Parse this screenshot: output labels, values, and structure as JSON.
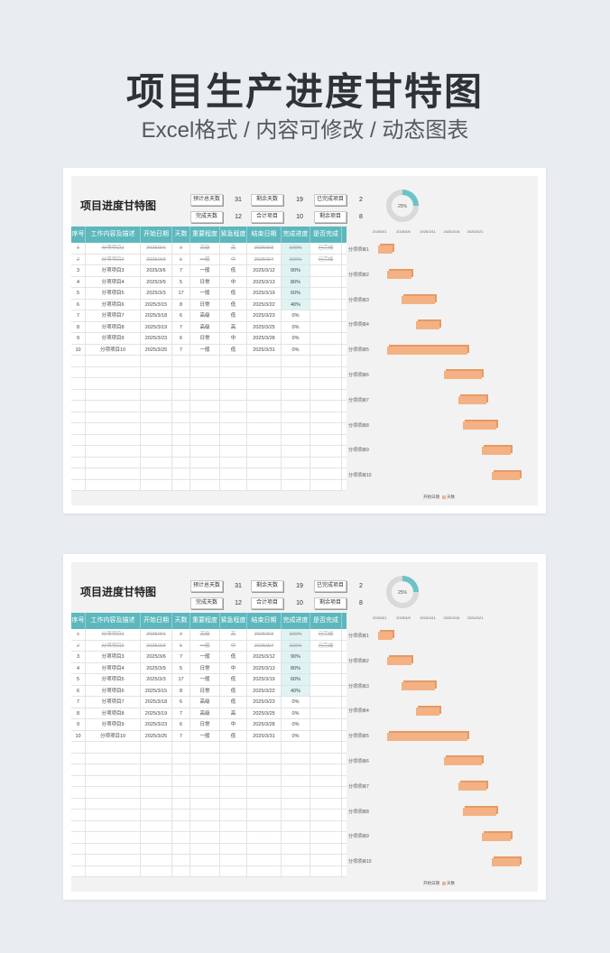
{
  "hero": {
    "title": "项目生产进度甘特图",
    "subtitle": "Excel格式 / 内容可修改 / 动态图表"
  },
  "sheet": {
    "title": "项目进度甘特图",
    "stats": [
      {
        "label": "预计总天数",
        "value": "31"
      },
      {
        "label": "剩余天数",
        "value": "19"
      },
      {
        "label": "已完成项目",
        "value": "2"
      },
      {
        "label": "完成天数",
        "value": "12"
      },
      {
        "label": "合计项目",
        "value": "10"
      },
      {
        "label": "剩余项目",
        "value": "8"
      }
    ],
    "donut": {
      "label": "25%",
      "value": 0.25,
      "color": "#6cc3c7",
      "track": "#d9d9d9"
    }
  },
  "table": {
    "headers": [
      "序号",
      "工作内容及描述",
      "开始日期",
      "天数",
      "重要程度",
      "紧急程度",
      "结束日期",
      "完成进度",
      "是否完成"
    ],
    "rows": [
      {
        "done": true,
        "cells": [
          "1",
          "分项项目1",
          "2025/3/1",
          "3",
          "高级",
          "高",
          "2025/3/3",
          "100%",
          "已完成"
        ]
      },
      {
        "done": true,
        "cells": [
          "2",
          "分项项目2",
          "2025/3/3",
          "5",
          "一般",
          "中",
          "2025/3/7",
          "100%",
          "已完成"
        ]
      },
      {
        "done": false,
        "cells": [
          "3",
          "分项项目3",
          "2025/3/6",
          "7",
          "一般",
          "低",
          "2025/3/12",
          "90%",
          ""
        ]
      },
      {
        "done": false,
        "cells": [
          "4",
          "分项项目4",
          "2025/3/9",
          "5",
          "日常",
          "中",
          "2025/3/13",
          "80%",
          ""
        ]
      },
      {
        "done": false,
        "cells": [
          "5",
          "分项项目5",
          "2025/3/3",
          "17",
          "一般",
          "低",
          "2025/3/19",
          "60%",
          ""
        ]
      },
      {
        "done": false,
        "cells": [
          "6",
          "分项项目6",
          "2025/3/15",
          "8",
          "日常",
          "低",
          "2025/3/22",
          "40%",
          ""
        ]
      },
      {
        "done": false,
        "cells": [
          "7",
          "分项项目7",
          "2025/3/18",
          "6",
          "高级",
          "低",
          "2025/3/23",
          "0%",
          ""
        ]
      },
      {
        "done": false,
        "cells": [
          "8",
          "分项项目8",
          "2025/3/19",
          "7",
          "高级",
          "高",
          "2025/3/25",
          "0%",
          ""
        ]
      },
      {
        "done": false,
        "cells": [
          "9",
          "分项项目9",
          "2025/3/23",
          "6",
          "日常",
          "中",
          "2025/3/28",
          "0%",
          ""
        ]
      },
      {
        "done": false,
        "cells": [
          "10",
          "分项项目10",
          "2025/3/25",
          "7",
          "一般",
          "低",
          "2025/3/31",
          "0%",
          ""
        ]
      }
    ],
    "blank_rows": 12
  },
  "chart_data": {
    "type": "bar",
    "orientation": "horizontal-gantt",
    "categories": [
      "分项项目1",
      "分项项目2",
      "分项项目3",
      "分项项目4",
      "分项项目5",
      "分项项目6",
      "分项项目7",
      "分项项目8",
      "分项项目9",
      "分项项目10"
    ],
    "x_ticks": [
      "2025/3/1",
      "2025/3/6",
      "2025/3/11",
      "2025/3/16",
      "2025/3/21"
    ],
    "series": [
      {
        "name": "开始日期",
        "values": [
          "2025/3/1",
          "2025/3/3",
          "2025/3/6",
          "2025/3/9",
          "2025/3/3",
          "2025/3/15",
          "2025/3/18",
          "2025/3/19",
          "2025/3/23",
          "2025/3/25"
        ],
        "visible": false
      },
      {
        "name": "天数",
        "values": [
          3,
          5,
          7,
          5,
          17,
          8,
          6,
          7,
          6,
          7
        ],
        "color": "#f4b183"
      }
    ],
    "xlim": [
      "2025/3/1",
      "2025/3/31"
    ]
  }
}
